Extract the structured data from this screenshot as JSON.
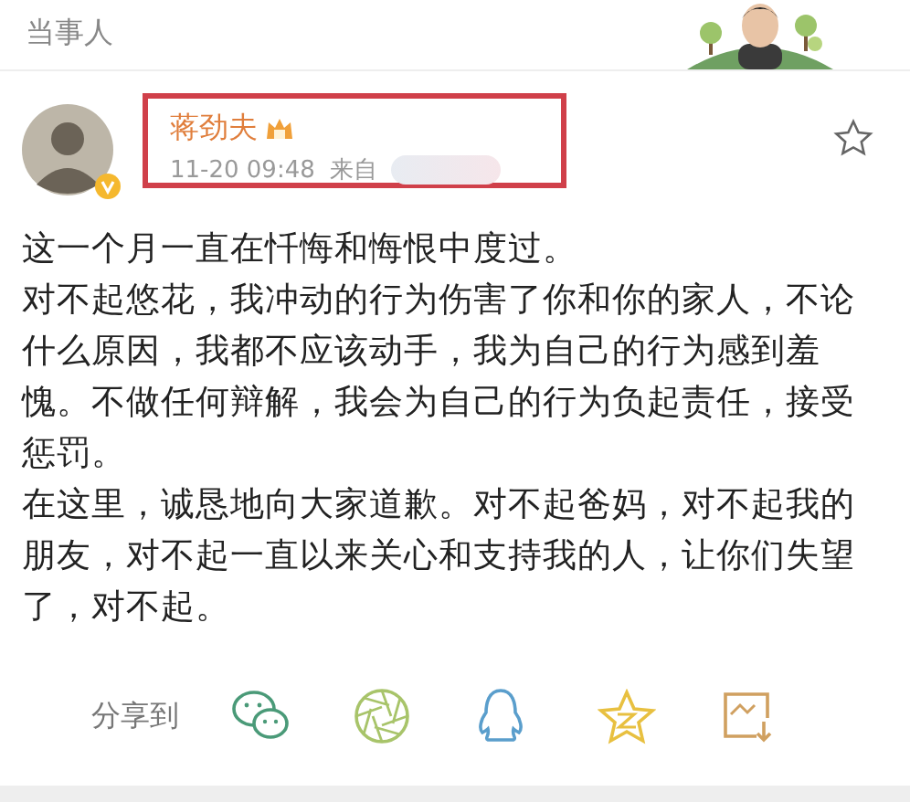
{
  "section": {
    "title": "当事人"
  },
  "post": {
    "author": "蒋劲夫",
    "time": "11-20 09:48",
    "source_prefix": "来自",
    "starred": false,
    "highlighted": true,
    "paragraphs": [
      "这一个月一直在忏悔和悔恨中度过。",
      "对不起悠花，我冲动的行为伤害了你和你的家人，不论什么原因，我都不应该动手，我为自己的行为感到羞愧。不做任何辩解，我会为自己的行为负起责任，接受惩罚。",
      "在这里，诚恳地向大家道歉。对不起爸妈，对不起我的朋友，对不起一直以来关心和支持我的人，让你们失望了，对不起。"
    ]
  },
  "share": {
    "label": "分享到",
    "targets": [
      {
        "kind": "wechat"
      },
      {
        "kind": "moments"
      },
      {
        "kind": "qq"
      },
      {
        "kind": "qzone"
      },
      {
        "kind": "save"
      }
    ]
  }
}
